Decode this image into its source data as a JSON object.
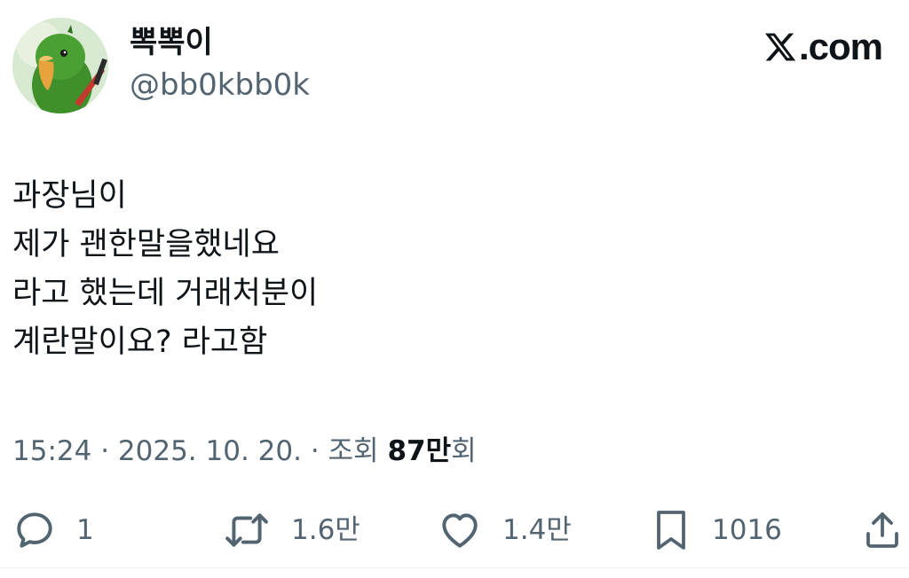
{
  "author": {
    "display_name": "뽁뽁이",
    "handle": "@bb0kbb0k"
  },
  "brand": {
    "text": ".com",
    "logo_icon": "x-logo-icon"
  },
  "tweet": {
    "lines": [
      "과장님이",
      "제가 괜한말을했네요",
      "라고 했는데 거래처분이",
      "계란말이요? 라고함"
    ]
  },
  "meta": {
    "time": "15:24",
    "separator": " · ",
    "date": "2025. 10. 20.",
    "views_prefix": "조회 ",
    "views_count": "87만",
    "views_suffix": "회"
  },
  "actions": {
    "reply": {
      "icon": "reply-icon",
      "count": "1"
    },
    "retweet": {
      "icon": "retweet-icon",
      "count": "1.6만"
    },
    "like": {
      "icon": "heart-icon",
      "count": "1.4만"
    },
    "bookmark": {
      "icon": "bookmark-icon",
      "count": "1016"
    },
    "share": {
      "icon": "share-icon"
    }
  },
  "colors": {
    "text_primary": "#0f1419",
    "text_secondary": "#536471",
    "divider": "#eff3f4"
  }
}
